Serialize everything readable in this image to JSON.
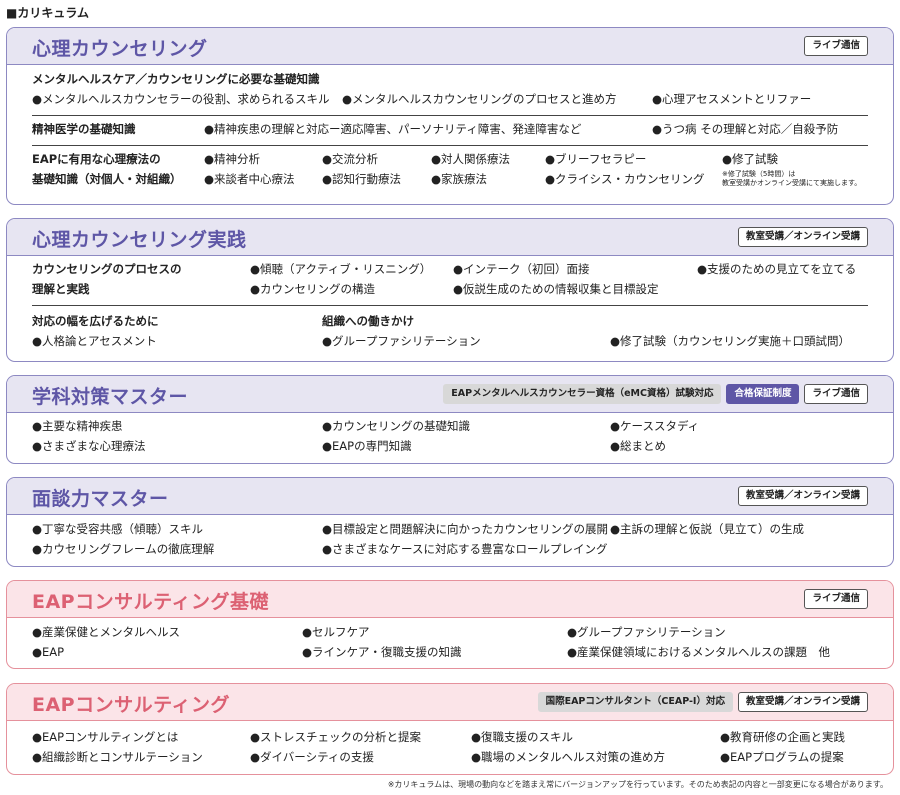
{
  "page_title": "■カリキュラム",
  "footnote": "※カリキュラムは、現場の動向などを踏まえ常にバージョンアップを行っています。そのため表記の内容と一部変更になる場合があります。",
  "s1": {
    "title": "心理カウンセリング",
    "tag": "ライブ通信",
    "g1_heading": "メンタルヘルスケア／カウンセリングに必要な基礎知識",
    "g1_items": [
      "●メンタルヘルスカウンセラーの役割、求められるスキル",
      "●メンタルヘルスカウンセリングのプロセスと進め方",
      "●心理アセスメントとリファー"
    ],
    "g2_heading": "精神医学の基礎知識",
    "g2_items": [
      "●精神疾患の理解と対応ー適応障害、パーソナリティ障害、発達障害など",
      "●うつ病 その理解と対応／自殺予防"
    ],
    "g3_heading_1": "EAPに有用な心理療法の",
    "g3_heading_2": "基礎知識（対個人・対組織）",
    "g3_row1": [
      "●精神分析",
      "●交流分析",
      "●対人関係療法",
      "●ブリーフセラピー",
      "●修了試験"
    ],
    "g3_row2": [
      "●来談者中心療法",
      "●認知行動療法",
      "●家族療法",
      "●クライシス・カウンセリング"
    ],
    "g3_note_1": "※修了試験（5時間）は",
    "g3_note_2": "教室受講かオンライン受講にて実施します。"
  },
  "s2": {
    "title": "心理カウンセリング実践",
    "tag": "教室受講／オンライン受講",
    "g1_heading_1": "カウンセリングのプロセスの",
    "g1_heading_2": "理解と実践",
    "g1_row1": [
      "●傾聴（アクティブ・リスニング）",
      "●インテーク（初回）面接",
      "●支援のための見立てを立てる"
    ],
    "g1_row2": [
      "●カウンセリングの構造",
      "●仮説生成のための情報収集と目標設定"
    ],
    "g2_heading_a": "対応の幅を広げるために",
    "g2_heading_b": "組織への働きかけ",
    "g2_items": [
      "●人格論とアセスメント",
      "●グループファシリテーション",
      "●修了試験（カウンセリング実施＋口頭試問）"
    ]
  },
  "s3": {
    "title": "学科対策マスター",
    "tag_exam": "EAPメンタルヘルスカウンセラー資格（eMC資格）試験対応",
    "tag_guarantee": "合格保証制度",
    "tag_live": "ライブ通信",
    "row1": [
      "●主要な精神疾患",
      "●カウンセリングの基礎知識",
      "●ケーススタディ"
    ],
    "row2": [
      "●さまざまな心理療法",
      "●EAPの専門知識",
      "●総まとめ"
    ]
  },
  "s4": {
    "title": "面談力マスター",
    "tag": "教室受講／オンライン受講",
    "row1": [
      "●丁寧な受容共感（傾聴）スキル",
      "●目標設定と問題解決に向かったカウンセリングの展開",
      "●主訴の理解と仮説（見立て）の生成"
    ],
    "row2": [
      "●カウセリングフレームの徹底理解",
      "●さまざまなケースに対応する豊富なロールプレイング"
    ]
  },
  "s5": {
    "title": "EAPコンサルティング基礎",
    "tag": "ライブ通信",
    "row1": [
      "●産業保健とメンタルヘルス",
      "●セルフケア",
      "●グループファシリテーション"
    ],
    "row2": [
      "●EAP",
      "●ラインケア・復職支援の知識",
      "●産業保健領域におけるメンタルヘルスの課題　他"
    ]
  },
  "s6": {
    "title": "EAPコンサルティング",
    "tag_ceap": "国際EAPコンサルタント（CEAP-I）対応",
    "tag": "教室受講／オンライン受講",
    "row1": [
      "●EAPコンサルティングとは",
      "●ストレスチェックの分析と提案",
      "●復職支援のスキル",
      "●教育研修の企画と実践"
    ],
    "row2": [
      "●組織診断とコンサルテーション",
      "●ダイバーシティの支援",
      "●職場のメンタルヘルス対策の進め方",
      "●EAPプログラムの提案"
    ]
  },
  "colors": {
    "purple_accent": "#5e56a6",
    "purple_bg": "#e7e5f2",
    "pink_accent": "#dc6173",
    "pink_bg": "#fbe4e8"
  }
}
